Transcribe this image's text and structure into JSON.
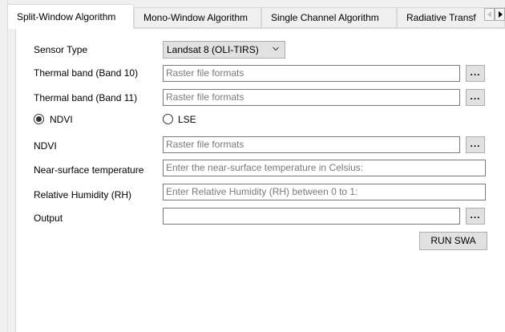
{
  "tabs": [
    {
      "label": "Split-Window Algorithm",
      "active": true
    },
    {
      "label": "Mono-Window Algorithm",
      "active": false
    },
    {
      "label": "Single Channel Algorithm",
      "active": false
    },
    {
      "label": "Radiative Transf",
      "active": false
    }
  ],
  "form": {
    "sensor_type_label": "Sensor Type",
    "sensor_type_value": "Landsat 8 (OLI-TIRS)",
    "band10_label": "Thermal band  (Band 10)",
    "band10_placeholder": "Raster file formats",
    "band11_label": "Thermal band   (Band 11)",
    "band11_placeholder": "Raster file formats",
    "radio_ndvi_label": "NDVI",
    "radio_lse_label": "LSE",
    "radio_selected": "NDVI",
    "ndvi_label": "NDVI",
    "ndvi_placeholder": "Raster file formats",
    "nst_label": "Near-surface temperature",
    "nst_placeholder": "Enter the near-surface temperature in Celsius:",
    "rh_label": "Relative Humidity (RH)",
    "rh_placeholder": "Enter Relative Humidity (RH) between 0 to 1:",
    "output_label": "Output",
    "output_value": "",
    "browse_label": "...",
    "run_label": "RUN SWA"
  }
}
